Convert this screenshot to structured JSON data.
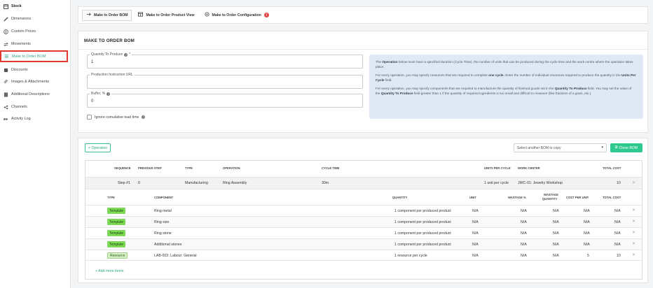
{
  "sidebar": {
    "items": [
      {
        "label": "Stock",
        "icon": "box-icon"
      },
      {
        "label": "Dimensions",
        "icon": "ruler-icon"
      },
      {
        "label": "Custom Prices",
        "icon": "price-icon"
      },
      {
        "label": "Movements",
        "icon": "arrows-icon"
      },
      {
        "label": "Make to Order BOM",
        "icon": "list-icon"
      },
      {
        "label": "Discounts",
        "icon": "tag-icon"
      },
      {
        "label": "Images & Attachments",
        "icon": "paperclip-icon"
      },
      {
        "label": "Additional Descriptions",
        "icon": "document-icon"
      },
      {
        "label": "Channels",
        "icon": "channels-icon"
      },
      {
        "label": "Activity Log",
        "icon": "activity-icon"
      }
    ]
  },
  "tabs": [
    {
      "label": "Make to Order BOM"
    },
    {
      "label": "Make to Order Product View"
    },
    {
      "label": "Make to Order Configuration",
      "badge": "!"
    }
  ],
  "form": {
    "title": "MAKE TO ORDER BOM",
    "quantity_label": "Quantity To Produce",
    "quantity_required": "*",
    "quantity_value": "1",
    "instruction_label": "Production Instruction URL",
    "instruction_value": "",
    "buffer_label": "Buffer, %",
    "buffer_value": "0",
    "ignore_label": "Ignore cumulative lead time"
  },
  "info": {
    "p1_a": "The ",
    "p1_b": "Operation",
    "p1_c": " below must have a specified duration (Cycle Time), the number of units that can be produced during the cycle time and the work centre where the operation takes place.",
    "p2_a": "For every operation, you may specify resources that are required to complete ",
    "p2_b": "one cycle",
    "p2_c": ". Enter the number of individual resources required to produce the quantity in the ",
    "p2_d": "Units Per Cycle",
    "p2_e": " field.",
    "p3_a": "For every operation, you may specify components that are required to manufacture the quantity of finished goods set in the ",
    "p3_b": "Quantity To Produce",
    "p3_c": " field. You may set the value of the ",
    "p3_d": "Quantity To Produce",
    "p3_e": " field greater than 1 if the quantity of required ingredients is too small and difficult to measure (like fractions of a gram, etc.)"
  },
  "ops": {
    "add_operation": "+ Operation",
    "select_placeholder": "Select another BOM to copy",
    "clone_button": "Clone BOM",
    "headers": {
      "sequence": "SEQUENCE",
      "previous_step": "PREVIOUS STEP",
      "type": "TYPE",
      "operation": "OPERATION",
      "cycle_time": "CYCLE TIME",
      "units_per_cycle": "UNITS PER CYCLE",
      "work_center": "WORK CENTER",
      "total_cost": "TOTAL COST"
    },
    "operation": {
      "sequence": "Step #1",
      "previous_step": "0",
      "type": "Manufacturing",
      "operation": "Ring Assembly",
      "cycle_time": "30m",
      "units_per_cycle": "1 unit per cycle",
      "work_center": "JWC-01: Jewelry Workshop",
      "total_cost": "10"
    },
    "sub_headers": {
      "type": "TYPE",
      "component": "COMPONENT",
      "quantity": "QUANTITY",
      "unit": "UNIT",
      "wastage": "WASTAGE %",
      "wastage_qty_1": "WASTAGE",
      "wastage_qty_2": "QUANTITY",
      "cost_per_unit": "COST PER UNIT",
      "total_cost": "TOTAL COST"
    },
    "items": [
      {
        "type": "Template",
        "component": "Ring metal",
        "quantity": "1 component per produced product",
        "unit": "N/A",
        "wastage": "N/A",
        "wastage_qty": "N/A",
        "cost_per_unit": "N/A",
        "total_cost": "N/A"
      },
      {
        "type": "Template",
        "component": "Ring size",
        "quantity": "1 component per produced product",
        "unit": "N/A",
        "wastage": "N/A",
        "wastage_qty": "N/A",
        "cost_per_unit": "N/A",
        "total_cost": "N/A"
      },
      {
        "type": "Template",
        "component": "Ring stone",
        "quantity": "1 component per produced product",
        "unit": "N/A",
        "wastage": "N/A",
        "wastage_qty": "N/A",
        "cost_per_unit": "N/A",
        "total_cost": "N/A"
      },
      {
        "type": "Template",
        "component": "Additional stones",
        "quantity": "1 component per produced product",
        "unit": "N/A",
        "wastage": "N/A",
        "wastage_qty": "N/A",
        "cost_per_unit": "N/A",
        "total_cost": "N/A"
      },
      {
        "type": "Resource",
        "component": "LAB-003: Labour: General",
        "quantity": "1 resource per cycle",
        "unit": "N/A",
        "wastage": "N/A",
        "wastage_qty": "N/A",
        "cost_per_unit": "5",
        "total_cost": "10"
      }
    ],
    "add_more": "+ Add more items"
  }
}
